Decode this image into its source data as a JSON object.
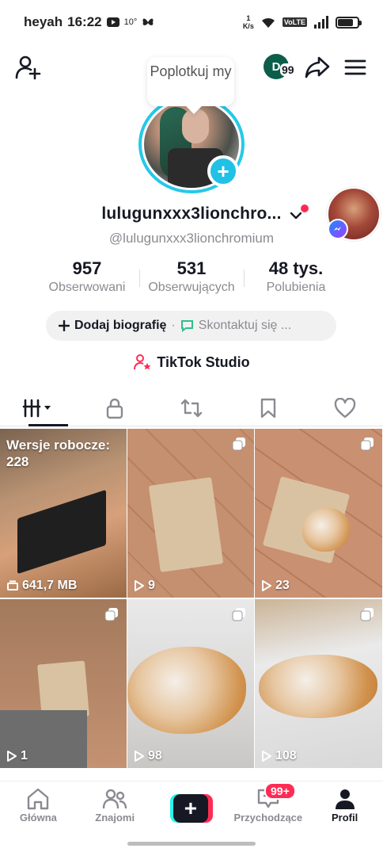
{
  "status_bar": {
    "carrier": "heyah",
    "time": "16:22",
    "temperature": "10°",
    "speed_value": "1",
    "speed_unit": "K/s",
    "volte": "VoLTE",
    "lte": "LTE"
  },
  "top_bar": {
    "avatar_letter": "D",
    "avatar_badge": "99"
  },
  "tooltip": "Poplotkuj my",
  "profile": {
    "display_name": "lulugunxxx3lionchro...",
    "handle": "@lulugunxxx3lionchromium"
  },
  "stats": [
    {
      "value": "957",
      "label": "Obserwowani"
    },
    {
      "value": "531",
      "label": "Obserwujących"
    },
    {
      "value": "48 tys.",
      "label": "Polubienia"
    }
  ],
  "bio": {
    "add_label": "Dodaj biografię",
    "separator": "·",
    "contact_label": "Skontaktuj się ..."
  },
  "studio_label": "TikTok Studio",
  "grid": {
    "drafts_label": "Wersje robocze:",
    "drafts_count": "228",
    "items": [
      {
        "label": "641,7 MB"
      },
      {
        "label": "9"
      },
      {
        "label": "23"
      },
      {
        "label": "1"
      },
      {
        "label": "98"
      },
      {
        "label": "108"
      }
    ]
  },
  "nav": {
    "home": "Główna",
    "friends": "Znajomi",
    "create": "+",
    "inbox": "Przychodzące",
    "inbox_badge": "99+",
    "profile": "Profil"
  }
}
